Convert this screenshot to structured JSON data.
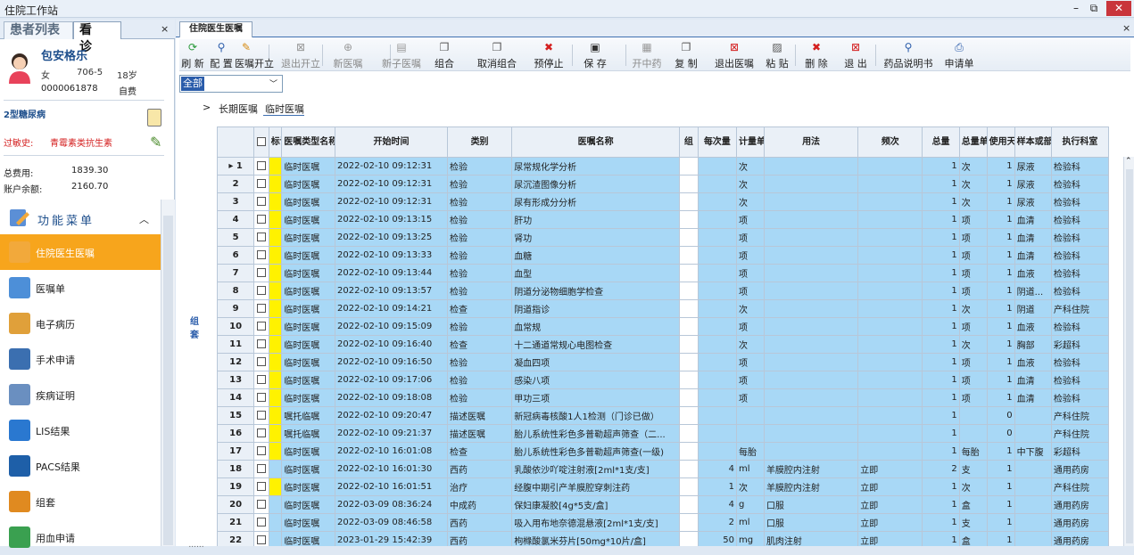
{
  "window": {
    "title": "住院工作站",
    "min": "–",
    "max": "⧉",
    "close": "✕"
  },
  "left_tabs": {
    "tab1": "患者列表",
    "tab2": "看 诊",
    "close": "×"
  },
  "patient": {
    "name": "包安格乐",
    "sex": "女",
    "bed": "706-5",
    "age": "18岁",
    "id": "0000061878",
    "payment": "自费",
    "diagnosis": "2型糖尿病",
    "allergy_label": "过敏史:",
    "allergy_value": "青霉素类抗生素",
    "fee_label": "总费用:",
    "fee_value": "1839.30",
    "balance_label": "账户余额:",
    "balance_value": "2160.70"
  },
  "menu": {
    "title": "功能菜单",
    "items": [
      {
        "label": "住院医生医嘱",
        "icon": "pencil-icon",
        "active": true
      },
      {
        "label": "医嘱单",
        "icon": "grid-icon",
        "active": false
      },
      {
        "label": "电子病历",
        "icon": "notepad-icon",
        "active": false
      },
      {
        "label": "手术申请",
        "icon": "document-add-icon",
        "active": false
      },
      {
        "label": "疾病证明",
        "icon": "chart-doc-icon",
        "active": false
      },
      {
        "label": "LIS结果",
        "icon": "flask-icon",
        "active": false
      },
      {
        "label": "PACS结果",
        "icon": "monitor-icon",
        "active": false
      },
      {
        "label": "组套",
        "icon": "book-icon",
        "active": false
      },
      {
        "label": "用血申请",
        "icon": "checklist-icon",
        "active": false
      }
    ]
  },
  "main_tab": {
    "label": "住院医生医嘱",
    "close": "×"
  },
  "toolbar": [
    {
      "label": "刷 新",
      "icon": "refresh-icon",
      "glyph": "⟳",
      "color": "#2a9a3a",
      "enabled": true
    },
    {
      "label": "配 置",
      "icon": "search-config-icon",
      "glyph": "⚲",
      "color": "#2a5caa",
      "enabled": true
    },
    {
      "label": "医嘱开立",
      "icon": "open-order-icon",
      "glyph": "✎",
      "color": "#d68a10",
      "enabled": true
    },
    {
      "label": "退出开立",
      "icon": "exit-open-icon",
      "glyph": "⊠",
      "color": "#999",
      "enabled": false
    },
    {
      "label": "新医嘱",
      "icon": "new-order-icon",
      "glyph": "⊕",
      "color": "#999",
      "enabled": false
    },
    {
      "label": "新子医嘱",
      "icon": "new-sub-order-icon",
      "glyph": "▤",
      "color": "#999",
      "enabled": false
    },
    {
      "label": "组合",
      "icon": "combine-icon",
      "glyph": "❐",
      "color": "#555",
      "enabled": true
    },
    {
      "label": "取消组合",
      "icon": "uncombine-icon",
      "glyph": "❐",
      "color": "#555",
      "enabled": true
    },
    {
      "label": "预停止",
      "icon": "pre-stop-icon",
      "glyph": "✖",
      "color": "#d42020",
      "enabled": true
    },
    {
      "label": "保 存",
      "icon": "save-icon",
      "glyph": "▣",
      "color": "#333",
      "enabled": true
    },
    {
      "label": "开中药",
      "icon": "herbal-icon",
      "glyph": "▦",
      "color": "#999",
      "enabled": false
    },
    {
      "label": "复 制",
      "icon": "copy-icon",
      "glyph": "❐",
      "color": "#555",
      "enabled": true
    },
    {
      "label": "退出医嘱",
      "icon": "exit-order-icon",
      "glyph": "⊠",
      "color": "#d42020",
      "enabled": true
    },
    {
      "label": "粘 贴",
      "icon": "paste-icon",
      "glyph": "▨",
      "color": "#555",
      "enabled": true
    },
    {
      "label": "删 除",
      "icon": "delete-icon",
      "glyph": "✖",
      "color": "#d42020",
      "enabled": true
    },
    {
      "label": "退 出",
      "icon": "exit-icon",
      "glyph": "⊠",
      "color": "#d42020",
      "enabled": true
    },
    {
      "label": "药品说明书",
      "icon": "drug-manual-icon",
      "glyph": "⚲",
      "color": "#2a5caa",
      "enabled": true
    },
    {
      "label": "申请单",
      "icon": "print-icon",
      "glyph": "⎙",
      "color": "#2a5caa",
      "enabled": true
    }
  ],
  "filter": {
    "value": "全部"
  },
  "subtabs": {
    "long": "长期医嘱",
    "temp": "临时医嘱"
  },
  "side_label": "组套",
  "grid": {
    "headers": [
      "",
      "标识",
      "医嘱类型名称",
      "开始时间",
      "类别",
      "医嘱名称",
      "组",
      "每次量",
      "计量单位",
      "用法",
      "频次",
      "总量",
      "总量单位",
      "使用天数",
      "样本或部位",
      "执行科室"
    ],
    "rows": [
      {
        "n": "1",
        "cur": "▸",
        "mk": "y",
        "type": "临时医嘱",
        "time": "2022-02-10 09:12:31",
        "cat": "检验",
        "name": "尿常规化学分析",
        "dose": "",
        "unit": "次",
        "usage": "",
        "freq": "",
        "total": "1",
        "tunit": "次",
        "days": "1",
        "sample": "尿液",
        "dept": "检验科"
      },
      {
        "n": "2",
        "mk": "y",
        "type": "临时医嘱",
        "time": "2022-02-10 09:12:31",
        "cat": "检验",
        "name": "尿沉渣图像分析",
        "dose": "",
        "unit": "次",
        "usage": "",
        "freq": "",
        "total": "1",
        "tunit": "次",
        "days": "1",
        "sample": "尿液",
        "dept": "检验科"
      },
      {
        "n": "3",
        "mk": "y",
        "type": "临时医嘱",
        "time": "2022-02-10 09:12:31",
        "cat": "检验",
        "name": "尿有形成分分析",
        "dose": "",
        "unit": "次",
        "usage": "",
        "freq": "",
        "total": "1",
        "tunit": "次",
        "days": "1",
        "sample": "尿液",
        "dept": "检验科"
      },
      {
        "n": "4",
        "mk": "y",
        "type": "临时医嘱",
        "time": "2022-02-10 09:13:15",
        "cat": "检验",
        "name": "肝功",
        "dose": "",
        "unit": "项",
        "usage": "",
        "freq": "",
        "total": "1",
        "tunit": "项",
        "days": "1",
        "sample": "血清",
        "dept": "检验科"
      },
      {
        "n": "5",
        "mk": "y",
        "type": "临时医嘱",
        "time": "2022-02-10 09:13:25",
        "cat": "检验",
        "name": "肾功",
        "dose": "",
        "unit": "项",
        "usage": "",
        "freq": "",
        "total": "1",
        "tunit": "项",
        "days": "1",
        "sample": "血清",
        "dept": "检验科"
      },
      {
        "n": "6",
        "mk": "y",
        "type": "临时医嘱",
        "time": "2022-02-10 09:13:33",
        "cat": "检验",
        "name": "血糖",
        "dose": "",
        "unit": "项",
        "usage": "",
        "freq": "",
        "total": "1",
        "tunit": "项",
        "days": "1",
        "sample": "血清",
        "dept": "检验科"
      },
      {
        "n": "7",
        "mk": "y",
        "type": "临时医嘱",
        "time": "2022-02-10 09:13:44",
        "cat": "检验",
        "name": "血型",
        "dose": "",
        "unit": "项",
        "usage": "",
        "freq": "",
        "total": "1",
        "tunit": "项",
        "days": "1",
        "sample": "血液",
        "dept": "检验科"
      },
      {
        "n": "8",
        "mk": "y",
        "type": "临时医嘱",
        "time": "2022-02-10 09:13:57",
        "cat": "检验",
        "name": "阴道分泌物细胞学检查",
        "dose": "",
        "unit": "项",
        "usage": "",
        "freq": "",
        "total": "1",
        "tunit": "项",
        "days": "1",
        "sample": "阴道...",
        "dept": "检验科"
      },
      {
        "n": "9",
        "mk": "y",
        "type": "临时医嘱",
        "time": "2022-02-10 09:14:21",
        "cat": "检查",
        "name": "阴道指诊",
        "dose": "",
        "unit": "次",
        "usage": "",
        "freq": "",
        "total": "1",
        "tunit": "次",
        "days": "1",
        "sample": "阴道",
        "dept": "产科住院"
      },
      {
        "n": "10",
        "mk": "y",
        "type": "临时医嘱",
        "time": "2022-02-10 09:15:09",
        "cat": "检验",
        "name": "血常规",
        "dose": "",
        "unit": "项",
        "usage": "",
        "freq": "",
        "total": "1",
        "tunit": "项",
        "days": "1",
        "sample": "血液",
        "dept": "检验科"
      },
      {
        "n": "11",
        "mk": "y",
        "type": "临时医嘱",
        "time": "2022-02-10 09:16:40",
        "cat": "检查",
        "name": "十二通道常规心电图检查",
        "dose": "",
        "unit": "次",
        "usage": "",
        "freq": "",
        "total": "1",
        "tunit": "次",
        "days": "1",
        "sample": "胸部",
        "dept": "彩超科"
      },
      {
        "n": "12",
        "mk": "y",
        "type": "临时医嘱",
        "time": "2022-02-10 09:16:50",
        "cat": "检验",
        "name": "凝血四项",
        "dose": "",
        "unit": "项",
        "usage": "",
        "freq": "",
        "total": "1",
        "tunit": "项",
        "days": "1",
        "sample": "血液",
        "dept": "检验科"
      },
      {
        "n": "13",
        "mk": "y",
        "type": "临时医嘱",
        "time": "2022-02-10 09:17:06",
        "cat": "检验",
        "name": "感染八项",
        "dose": "",
        "unit": "项",
        "usage": "",
        "freq": "",
        "total": "1",
        "tunit": "项",
        "days": "1",
        "sample": "血清",
        "dept": "检验科"
      },
      {
        "n": "14",
        "mk": "y",
        "type": "临时医嘱",
        "time": "2022-02-10 09:18:08",
        "cat": "检验",
        "name": "甲功三项",
        "dose": "",
        "unit": "项",
        "usage": "",
        "freq": "",
        "total": "1",
        "tunit": "项",
        "days": "1",
        "sample": "血清",
        "dept": "检验科"
      },
      {
        "n": "15",
        "mk": "y",
        "type": "嘱托临嘱",
        "time": "2022-02-10 09:20:47",
        "cat": "描述医嘱",
        "name": "新冠病毒核酸1人1检测（门诊已做）",
        "dose": "",
        "unit": "",
        "usage": "",
        "freq": "",
        "total": "1",
        "tunit": "",
        "days": "0",
        "sample": "",
        "dept": "产科住院"
      },
      {
        "n": "16",
        "mk": "y",
        "type": "嘱托临嘱",
        "time": "2022-02-10 09:21:37",
        "cat": "描述医嘱",
        "name": "胎儿系统性彩色多普勒超声筛查（二...",
        "dose": "",
        "unit": "",
        "usage": "",
        "freq": "",
        "total": "1",
        "tunit": "",
        "days": "0",
        "sample": "",
        "dept": "产科住院"
      },
      {
        "n": "17",
        "mk": "y",
        "type": "临时医嘱",
        "time": "2022-02-10 16:01:08",
        "cat": "检查",
        "name": "胎儿系统性彩色多普勒超声筛查(一级)",
        "dose": "",
        "unit": "每胎",
        "usage": "",
        "freq": "",
        "total": "1",
        "tunit": "每胎",
        "days": "1",
        "sample": "中下腹",
        "dept": "彩超科"
      },
      {
        "n": "18",
        "mk": "g",
        "type": "临时医嘱",
        "time": "2022-02-10 16:01:30",
        "cat": "西药",
        "name": "乳酸依沙吖啶注射液[2ml*1支/支]",
        "dose": "4",
        "unit": "ml",
        "usage": "羊膜腔内注射",
        "freq": "立即",
        "total": "2",
        "tunit": "支",
        "days": "1",
        "sample": "",
        "dept": "通用药房"
      },
      {
        "n": "19",
        "mk": "y",
        "type": "临时医嘱",
        "time": "2022-02-10 16:01:51",
        "cat": "治疗",
        "name": "经腹中期引产羊膜腔穿刺注药",
        "dose": "1",
        "unit": "次",
        "usage": "羊膜腔内注射",
        "freq": "立即",
        "total": "1",
        "tunit": "次",
        "days": "1",
        "sample": "",
        "dept": "产科住院"
      },
      {
        "n": "20",
        "mk": "g",
        "type": "临时医嘱",
        "time": "2022-03-09 08:36:24",
        "cat": "中成药",
        "name": "保妇康凝胶[4g*5支/盒]",
        "dose": "4",
        "unit": "g",
        "usage": "口服",
        "freq": "立即",
        "total": "1",
        "tunit": "盒",
        "days": "1",
        "sample": "",
        "dept": "通用药房"
      },
      {
        "n": "21",
        "mk": "g",
        "type": "临时医嘱",
        "time": "2022-03-09 08:46:58",
        "cat": "西药",
        "name": "吸入用布地奈德混悬液[2ml*1支/支]",
        "dose": "2",
        "unit": "ml",
        "usage": "口服",
        "freq": "立即",
        "total": "1",
        "tunit": "支",
        "days": "1",
        "sample": "",
        "dept": "通用药房"
      },
      {
        "n": "22",
        "mk": "g",
        "type": "临时医嘱",
        "time": "2023-01-29 15:42:39",
        "cat": "西药",
        "name": "枸橼酸氯米芬片[50mg*10片/盒]",
        "dose": "50",
        "unit": "mg",
        "usage": "肌肉注射",
        "freq": "立即",
        "total": "1",
        "tunit": "盒",
        "days": "1",
        "sample": "",
        "dept": "通用药房"
      }
    ]
  },
  "bottom_dots": "......"
}
